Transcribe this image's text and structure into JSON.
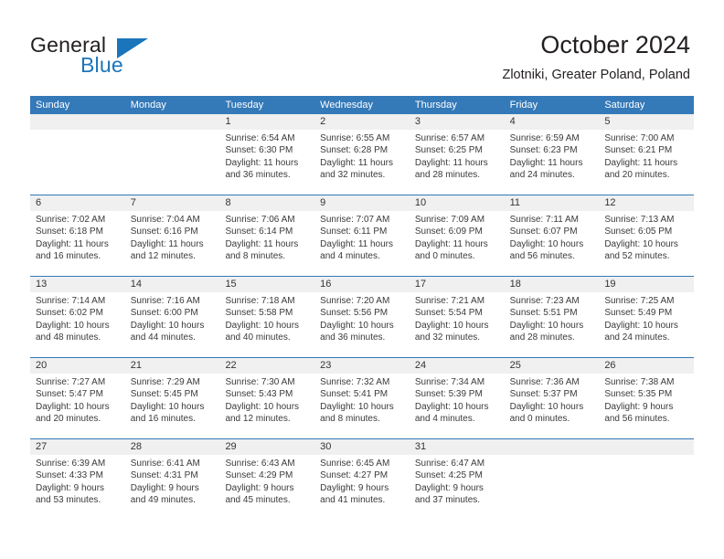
{
  "brand": {
    "word1": "General",
    "word2": "Blue",
    "logo_icon": "blue-triangle-icon",
    "accent_color": "#1b75bb"
  },
  "header": {
    "title": "October 2024",
    "subtitle": "Zlotniki, Greater Poland, Poland"
  },
  "theme": {
    "header_band": "#3479b8",
    "day_number_strip": "#f0f0f0",
    "text": "#3a3a3a"
  },
  "calendar": {
    "weekday_headers": [
      "Sunday",
      "Monday",
      "Tuesday",
      "Wednesday",
      "Thursday",
      "Friday",
      "Saturday"
    ],
    "labels": {
      "sunrise": "Sunrise:",
      "sunset": "Sunset:",
      "daylight": "Daylight:"
    },
    "weeks": [
      [
        {
          "day": "",
          "empty": true
        },
        {
          "day": "",
          "empty": true
        },
        {
          "day": "1",
          "sunrise": "Sunrise: 6:54 AM",
          "sunset": "Sunset: 6:30 PM",
          "daylight_line1": "Daylight: 11 hours",
          "daylight_line2": "and 36 minutes."
        },
        {
          "day": "2",
          "sunrise": "Sunrise: 6:55 AM",
          "sunset": "Sunset: 6:28 PM",
          "daylight_line1": "Daylight: 11 hours",
          "daylight_line2": "and 32 minutes."
        },
        {
          "day": "3",
          "sunrise": "Sunrise: 6:57 AM",
          "sunset": "Sunset: 6:25 PM",
          "daylight_line1": "Daylight: 11 hours",
          "daylight_line2": "and 28 minutes."
        },
        {
          "day": "4",
          "sunrise": "Sunrise: 6:59 AM",
          "sunset": "Sunset: 6:23 PM",
          "daylight_line1": "Daylight: 11 hours",
          "daylight_line2": "and 24 minutes."
        },
        {
          "day": "5",
          "sunrise": "Sunrise: 7:00 AM",
          "sunset": "Sunset: 6:21 PM",
          "daylight_line1": "Daylight: 11 hours",
          "daylight_line2": "and 20 minutes."
        }
      ],
      [
        {
          "day": "6",
          "sunrise": "Sunrise: 7:02 AM",
          "sunset": "Sunset: 6:18 PM",
          "daylight_line1": "Daylight: 11 hours",
          "daylight_line2": "and 16 minutes."
        },
        {
          "day": "7",
          "sunrise": "Sunrise: 7:04 AM",
          "sunset": "Sunset: 6:16 PM",
          "daylight_line1": "Daylight: 11 hours",
          "daylight_line2": "and 12 minutes."
        },
        {
          "day": "8",
          "sunrise": "Sunrise: 7:06 AM",
          "sunset": "Sunset: 6:14 PM",
          "daylight_line1": "Daylight: 11 hours",
          "daylight_line2": "and 8 minutes."
        },
        {
          "day": "9",
          "sunrise": "Sunrise: 7:07 AM",
          "sunset": "Sunset: 6:11 PM",
          "daylight_line1": "Daylight: 11 hours",
          "daylight_line2": "and 4 minutes."
        },
        {
          "day": "10",
          "sunrise": "Sunrise: 7:09 AM",
          "sunset": "Sunset: 6:09 PM",
          "daylight_line1": "Daylight: 11 hours",
          "daylight_line2": "and 0 minutes."
        },
        {
          "day": "11",
          "sunrise": "Sunrise: 7:11 AM",
          "sunset": "Sunset: 6:07 PM",
          "daylight_line1": "Daylight: 10 hours",
          "daylight_line2": "and 56 minutes."
        },
        {
          "day": "12",
          "sunrise": "Sunrise: 7:13 AM",
          "sunset": "Sunset: 6:05 PM",
          "daylight_line1": "Daylight: 10 hours",
          "daylight_line2": "and 52 minutes."
        }
      ],
      [
        {
          "day": "13",
          "sunrise": "Sunrise: 7:14 AM",
          "sunset": "Sunset: 6:02 PM",
          "daylight_line1": "Daylight: 10 hours",
          "daylight_line2": "and 48 minutes."
        },
        {
          "day": "14",
          "sunrise": "Sunrise: 7:16 AM",
          "sunset": "Sunset: 6:00 PM",
          "daylight_line1": "Daylight: 10 hours",
          "daylight_line2": "and 44 minutes."
        },
        {
          "day": "15",
          "sunrise": "Sunrise: 7:18 AM",
          "sunset": "Sunset: 5:58 PM",
          "daylight_line1": "Daylight: 10 hours",
          "daylight_line2": "and 40 minutes."
        },
        {
          "day": "16",
          "sunrise": "Sunrise: 7:20 AM",
          "sunset": "Sunset: 5:56 PM",
          "daylight_line1": "Daylight: 10 hours",
          "daylight_line2": "and 36 minutes."
        },
        {
          "day": "17",
          "sunrise": "Sunrise: 7:21 AM",
          "sunset": "Sunset: 5:54 PM",
          "daylight_line1": "Daylight: 10 hours",
          "daylight_line2": "and 32 minutes."
        },
        {
          "day": "18",
          "sunrise": "Sunrise: 7:23 AM",
          "sunset": "Sunset: 5:51 PM",
          "daylight_line1": "Daylight: 10 hours",
          "daylight_line2": "and 28 minutes."
        },
        {
          "day": "19",
          "sunrise": "Sunrise: 7:25 AM",
          "sunset": "Sunset: 5:49 PM",
          "daylight_line1": "Daylight: 10 hours",
          "daylight_line2": "and 24 minutes."
        }
      ],
      [
        {
          "day": "20",
          "sunrise": "Sunrise: 7:27 AM",
          "sunset": "Sunset: 5:47 PM",
          "daylight_line1": "Daylight: 10 hours",
          "daylight_line2": "and 20 minutes."
        },
        {
          "day": "21",
          "sunrise": "Sunrise: 7:29 AM",
          "sunset": "Sunset: 5:45 PM",
          "daylight_line1": "Daylight: 10 hours",
          "daylight_line2": "and 16 minutes."
        },
        {
          "day": "22",
          "sunrise": "Sunrise: 7:30 AM",
          "sunset": "Sunset: 5:43 PM",
          "daylight_line1": "Daylight: 10 hours",
          "daylight_line2": "and 12 minutes."
        },
        {
          "day": "23",
          "sunrise": "Sunrise: 7:32 AM",
          "sunset": "Sunset: 5:41 PM",
          "daylight_line1": "Daylight: 10 hours",
          "daylight_line2": "and 8 minutes."
        },
        {
          "day": "24",
          "sunrise": "Sunrise: 7:34 AM",
          "sunset": "Sunset: 5:39 PM",
          "daylight_line1": "Daylight: 10 hours",
          "daylight_line2": "and 4 minutes."
        },
        {
          "day": "25",
          "sunrise": "Sunrise: 7:36 AM",
          "sunset": "Sunset: 5:37 PM",
          "daylight_line1": "Daylight: 10 hours",
          "daylight_line2": "and 0 minutes."
        },
        {
          "day": "26",
          "sunrise": "Sunrise: 7:38 AM",
          "sunset": "Sunset: 5:35 PM",
          "daylight_line1": "Daylight: 9 hours",
          "daylight_line2": "and 56 minutes."
        }
      ],
      [
        {
          "day": "27",
          "sunrise": "Sunrise: 6:39 AM",
          "sunset": "Sunset: 4:33 PM",
          "daylight_line1": "Daylight: 9 hours",
          "daylight_line2": "and 53 minutes."
        },
        {
          "day": "28",
          "sunrise": "Sunrise: 6:41 AM",
          "sunset": "Sunset: 4:31 PM",
          "daylight_line1": "Daylight: 9 hours",
          "daylight_line2": "and 49 minutes."
        },
        {
          "day": "29",
          "sunrise": "Sunrise: 6:43 AM",
          "sunset": "Sunset: 4:29 PM",
          "daylight_line1": "Daylight: 9 hours",
          "daylight_line2": "and 45 minutes."
        },
        {
          "day": "30",
          "sunrise": "Sunrise: 6:45 AM",
          "sunset": "Sunset: 4:27 PM",
          "daylight_line1": "Daylight: 9 hours",
          "daylight_line2": "and 41 minutes."
        },
        {
          "day": "31",
          "sunrise": "Sunrise: 6:47 AM",
          "sunset": "Sunset: 4:25 PM",
          "daylight_line1": "Daylight: 9 hours",
          "daylight_line2": "and 37 minutes."
        },
        {
          "day": "",
          "empty": true
        },
        {
          "day": "",
          "empty": true
        }
      ]
    ]
  }
}
